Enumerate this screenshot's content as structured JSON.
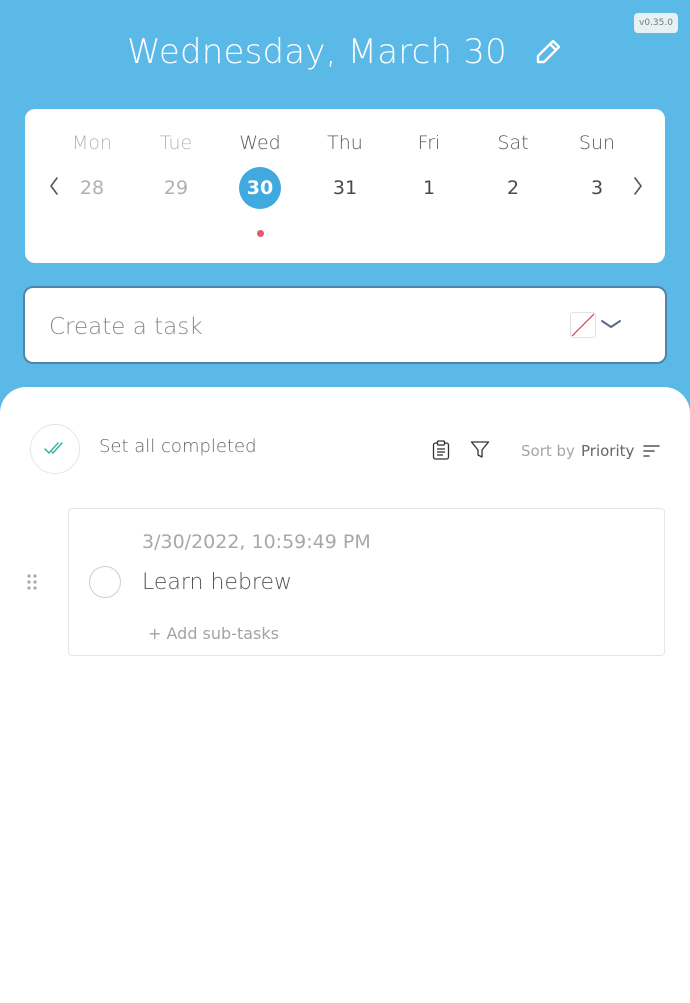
{
  "app": {
    "version": "v0.35.0"
  },
  "header": {
    "title": "Wednesday, March 30",
    "edit_icon": "pencil-icon"
  },
  "calendar": {
    "day_names": [
      "Mon",
      "Tue",
      "Wed",
      "Thu",
      "Fri",
      "Sat",
      "Sun"
    ],
    "dates": [
      "28",
      "29",
      "30",
      "31",
      "1",
      "2",
      "3"
    ],
    "selected_index": 2,
    "past_indices": [
      0,
      1
    ],
    "prev_icon": "chevron-left-icon",
    "next_icon": "chevron-right-icon",
    "indicator_dot_color": "#e9576e",
    "selected_color": "#3fa9e0"
  },
  "create_task": {
    "placeholder": "Create a task",
    "color_picker": "no-color",
    "dropdown_icon": "chevron-down-icon"
  },
  "toolbar": {
    "set_all_completed": "Set all completed",
    "clipboard_icon": "clipboard-icon",
    "filter_icon": "filter-icon",
    "sort_label": "Sort by",
    "sort_value": "Priority",
    "sort_icon": "sort-lines-icon"
  },
  "tasks": [
    {
      "timestamp": "3/30/2022, 10:59:49 PM",
      "title": "Learn hebrew",
      "add_subtasks": "+ Add sub-tasks",
      "completed": false
    }
  ],
  "colors": {
    "background": "#5bb9e8",
    "check_accent": "#35b3a0"
  }
}
